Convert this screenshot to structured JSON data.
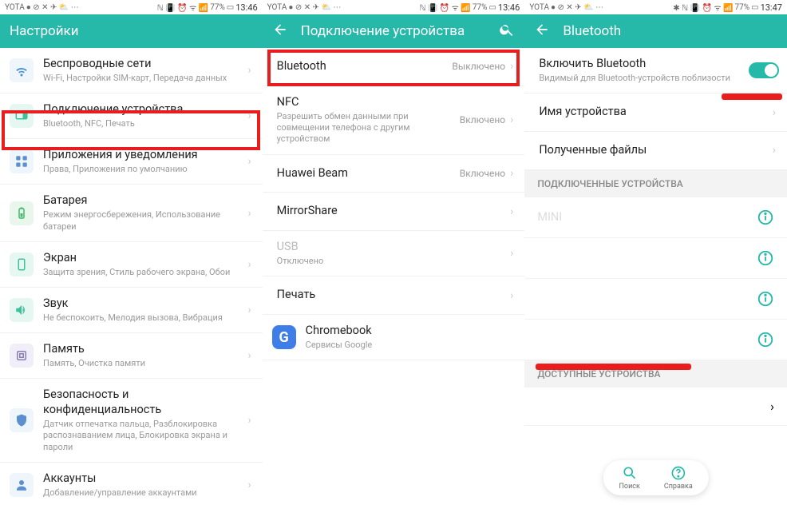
{
  "screen1": {
    "statusbar": {
      "carrier": "YOTA",
      "battery": "77%",
      "time": "13:46"
    },
    "header": {
      "title": "Настройки"
    },
    "items": [
      {
        "icon": "wifi",
        "title": "Беспроводные сети",
        "sub": "Wi-Fi, Настройки SIM-карт, Передача данных"
      },
      {
        "icon": "device",
        "title": "Подключение устройства",
        "sub": "Bluetooth, NFC, Печать",
        "highlight": true
      },
      {
        "icon": "apps",
        "title": "Приложения и уведомления",
        "sub": "Права, Приложения по умолчанию"
      },
      {
        "icon": "battery",
        "title": "Батарея",
        "sub": "Режим энергосбережения, Использование батареи"
      },
      {
        "icon": "display",
        "title": "Экран",
        "sub": "Защита зрения, Стиль рабочего экрана, Обои"
      },
      {
        "icon": "sound",
        "title": "Звук",
        "sub": "Не беспокоить, Мелодия вызова, Вибрация"
      },
      {
        "icon": "memory",
        "title": "Память",
        "sub": "Память, Очистка памяти"
      },
      {
        "icon": "security",
        "title": "Безопасность и конфиденциальность",
        "sub": "Датчик отпечатка пальца, Разблокировка распознаванием лица, Блокировка экрана и пароли"
      },
      {
        "icon": "accounts",
        "title": "Аккаунты",
        "sub": "Добавление/управление аккаунтами"
      }
    ]
  },
  "screen2": {
    "statusbar": {
      "carrier": "YOTA",
      "battery": "77%",
      "time": "13:46"
    },
    "header": {
      "title": "Подключение устройства"
    },
    "items": [
      {
        "title": "Bluetooth",
        "value": "Выключено",
        "highlight": true
      },
      {
        "title": "NFC",
        "sub": "Разрешить обмен данными при совмещении телефона с другим устройством",
        "value": "Включено"
      },
      {
        "title": "Huawei Beam",
        "value": "Включено"
      },
      {
        "title": "MirrorShare"
      },
      {
        "title": "USB",
        "sub": "Отключено",
        "disabled": true
      },
      {
        "title": "Печать"
      },
      {
        "title": "Chromebook",
        "sub": "Сервисы Google",
        "icon": "google"
      }
    ]
  },
  "screen3": {
    "statusbar": {
      "carrier": "YOTA",
      "battery": "77%",
      "time": "13:47"
    },
    "header": {
      "title": "Bluetooth"
    },
    "enable": {
      "title": "Включить Bluetooth",
      "sub": "Видимый для Bluetooth-устройств поблизости"
    },
    "rows": [
      {
        "title": "Имя устройства"
      },
      {
        "title": "Полученные файлы"
      }
    ],
    "section1": "ПОДКЛЮЧЕННЫЕ УСТРОЙСТВА",
    "paired": [
      {
        "title": "MINI"
      },
      {
        "title": ""
      },
      {
        "title": ""
      },
      {
        "title": ""
      }
    ],
    "section2": "ДОСТУПНЫЕ УСТРОЙСТВА",
    "avail": [
      {
        "title": ""
      }
    ],
    "fab": {
      "search": "Поиск",
      "help": "Справка"
    }
  }
}
